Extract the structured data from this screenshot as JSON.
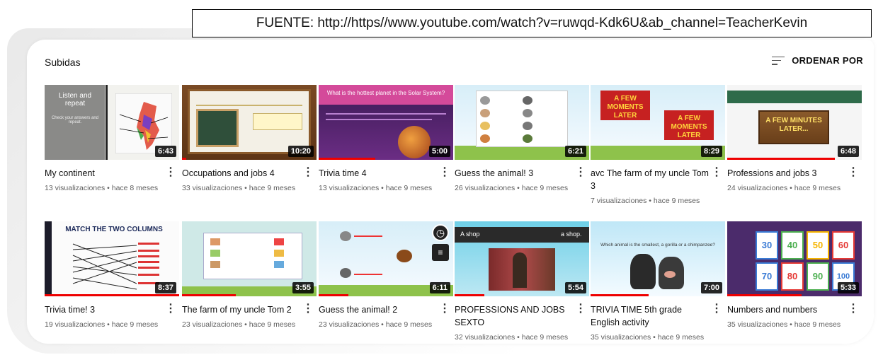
{
  "source_note": "FUENTE: http://https//www.youtube.com/watch?v=ruwqd-Kdk6U&ab_channel=TeacherKevin",
  "section": {
    "title": "Subidas",
    "sort_label": "ORDENAR POR"
  },
  "colors": {
    "progress": "#ee0000",
    "duration_bg": "#000000",
    "stats_text": "#606060"
  },
  "thumb_text": {
    "v1_heading": "Listen and repeat",
    "v1_sub": "Check your answers and repeat.",
    "v3_question": "What is the hottest planet in the Solar System?",
    "v5_caption": "A FEW MOMENTS LATER",
    "v6_caption": "A FEW MINUTES LATER...",
    "v7_heading": "MATCH THE TWO COLUMNS",
    "v10_left": "A shop",
    "v10_right": "a shop.",
    "v11_question": "Which animal is the smallest, a gorilla or a chimpanzee?",
    "v12_numbers": [
      "30",
      "40",
      "50",
      "60",
      "70",
      "80",
      "90",
      "100"
    ]
  },
  "videos": [
    {
      "title": "My continent",
      "stats": "13 visualizaciones • hace 8 meses",
      "duration": "6:43",
      "watched": 0
    },
    {
      "title": "Occupations and jobs 4",
      "stats": "33 visualizaciones • hace 9 meses",
      "duration": "10:20",
      "watched": 0.03
    },
    {
      "title": "Trivia time 4",
      "stats": "13 visualizaciones • hace 9 meses",
      "duration": "5:00",
      "watched": 0.42
    },
    {
      "title": "Guess the animal! 3",
      "stats": "26 visualizaciones • hace 9 meses",
      "duration": "6:21",
      "watched": 0
    },
    {
      "title": "avc The farm of my uncle Tom 3",
      "stats": "7 visualizaciones • hace 9 meses",
      "duration": "8:29",
      "watched": 0
    },
    {
      "title": "Professions and jobs 3",
      "stats": "24 visualizaciones • hace 9 meses",
      "duration": "6:48",
      "watched": 0.8
    },
    {
      "title": "Trivia time! 3",
      "stats": "19 visualizaciones • hace 9 meses",
      "duration": "8:37",
      "watched": 1.0
    },
    {
      "title": "The farm of my uncle Tom 2",
      "stats": "23 visualizaciones • hace 9 meses",
      "duration": "3:55",
      "watched": 0.4
    },
    {
      "title": "Guess the animal! 2",
      "stats": "23 visualizaciones • hace 9 meses",
      "duration": "6:11",
      "watched": 0.22
    },
    {
      "title": "PROFESSIONS AND JOBS SEXTO",
      "stats": "32 visualizaciones • hace 9 meses",
      "duration": "5:54",
      "watched": 0.22
    },
    {
      "title": "TRIVIA TIME 5th grade English activity",
      "stats": "35 visualizaciones • hace 9 meses",
      "duration": "7:00",
      "watched": 0.43
    },
    {
      "title": "Numbers and numbers",
      "stats": "35 visualizaciones • hace 9 meses",
      "duration": "5:33",
      "watched": 0.55
    }
  ]
}
